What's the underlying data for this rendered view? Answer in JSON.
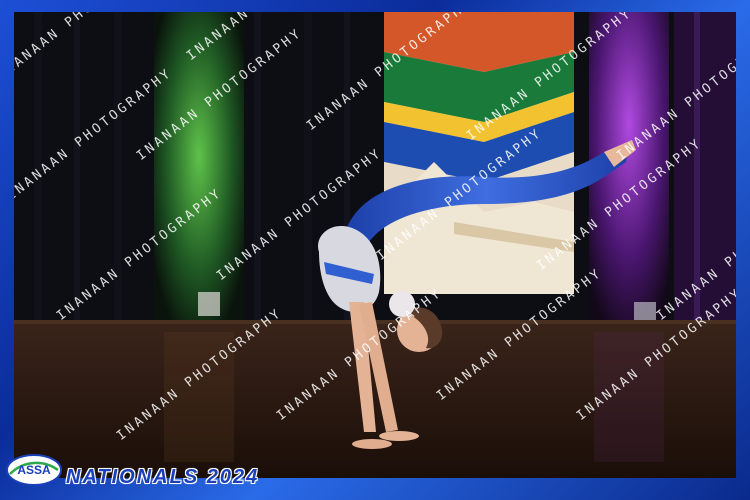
{
  "event_title": "NATIONALS 2024",
  "logo_text": "ASSA",
  "watermark_text": "INANAAN PHOTOGRAPHY",
  "colors": {
    "frame_blue": "#1d4fd6",
    "costume_blue": "#2f5fd0",
    "stage_floor": "#2a1810",
    "curtain_green": "#2f8a3a",
    "curtain_purple": "#7a2aa8"
  }
}
